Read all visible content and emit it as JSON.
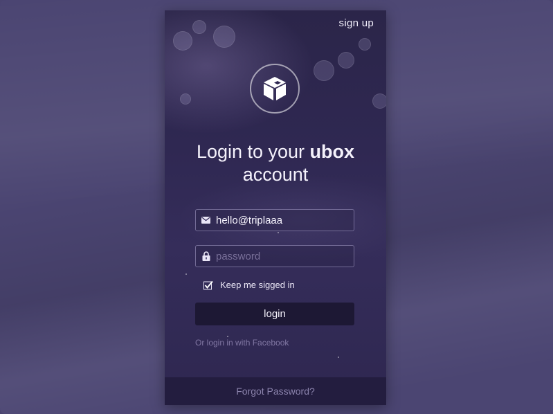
{
  "header": {
    "signup_label": "sign up"
  },
  "logo": {
    "icon": "box-icon"
  },
  "title": {
    "prefix": "Login to your ",
    "brand": "ubox",
    "suffix": "account"
  },
  "email_field": {
    "icon": "mail-icon",
    "value": "hello@triplaaa"
  },
  "password_field": {
    "icon": "lock-icon",
    "placeholder": "password"
  },
  "remember": {
    "checked": true,
    "label": "Keep me sigged in"
  },
  "login_button": {
    "label": "login"
  },
  "facebook_link": {
    "label": "Or login in with Facebook"
  },
  "forgot": {
    "label": "Forgot Password?"
  },
  "colors": {
    "backdrop": "#4b4572",
    "panel": "#2f2852",
    "button": "#1d1834",
    "footer": "#231d3f"
  }
}
